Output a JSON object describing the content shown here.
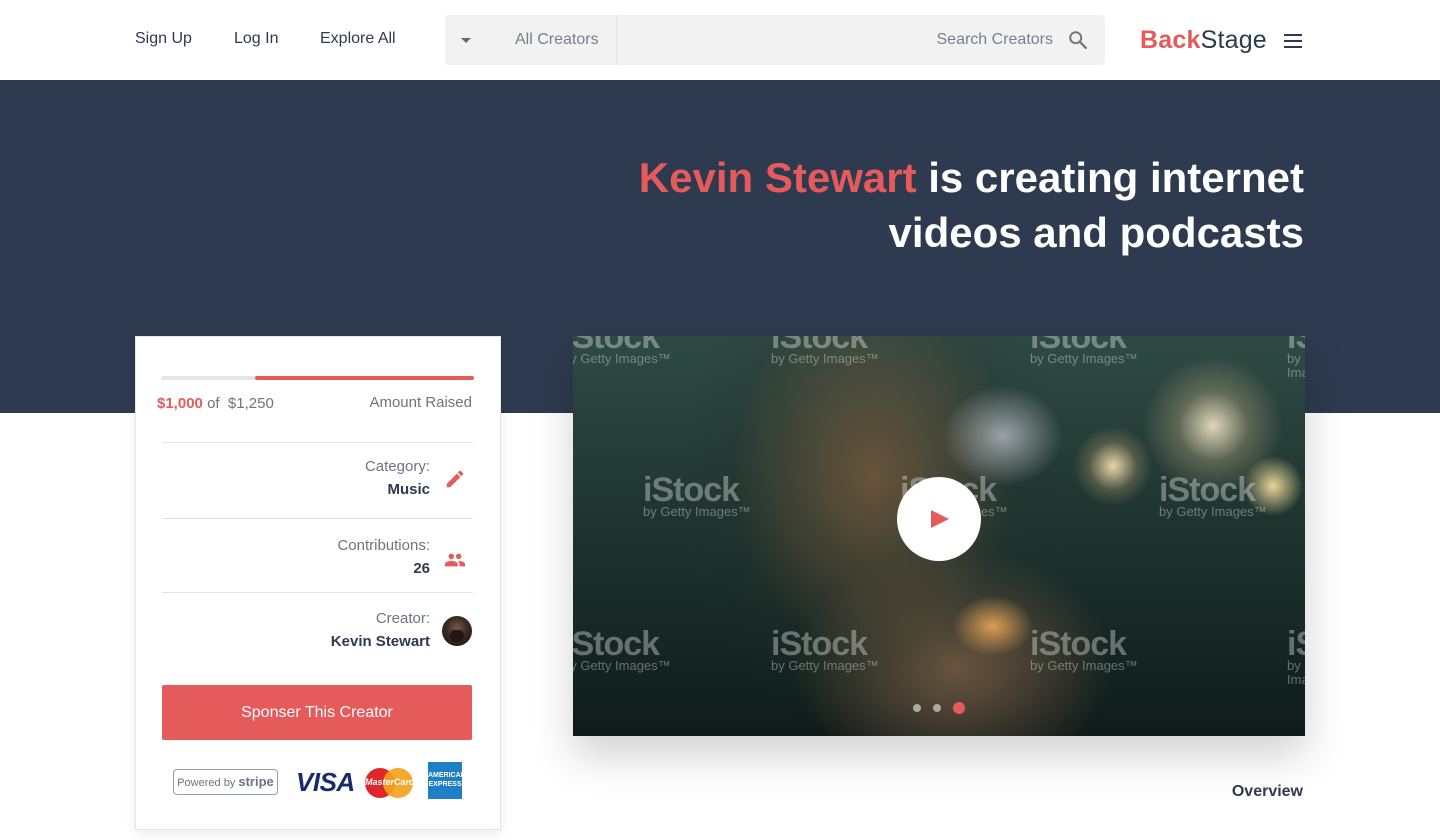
{
  "nav": {
    "sign_up": "Sign Up",
    "log_in": "Log In",
    "explore_all": "Explore All"
  },
  "search": {
    "dropdown_value": "All Creators",
    "placeholder": "Search Creators",
    "icon": "search-icon"
  },
  "brand": {
    "part1": "Back",
    "part2": "Stage",
    "accent_color": "#e55b5b",
    "dark_color": "#2e3a4e"
  },
  "hero": {
    "creator_name": "Kevin Stewart",
    "headline_rest": " is creating internet videos and podcasts",
    "background_color": "#2e3a4f"
  },
  "funding": {
    "raised": "$1,000",
    "of_text": "of",
    "goal": "$1,250",
    "label": "Amount Raised",
    "progress_start_fraction": 0.3,
    "progress_fraction": 0.7
  },
  "details": {
    "category_label": "Category:",
    "category_value": "Music",
    "category_icon": "pencil-icon",
    "contributions_label": "Contributions:",
    "contributions_value": "26",
    "contributions_icon": "people-icon",
    "creator_label": "Creator:",
    "creator_value": "Kevin Stewart"
  },
  "sponsor_button": "Sponser This Creator",
  "payments": {
    "stripe_text": "Powered by",
    "stripe_brand": "stripe",
    "visa": "VISA",
    "mastercard": "MasterCard",
    "amex": "AMERICAN EXPRESS"
  },
  "video": {
    "watermark_brand": "iStock",
    "watermark_sub": "by Getty Images™",
    "play_icon": "play-icon",
    "slides": 3,
    "active_slide": 3
  },
  "overview_link": "Overview"
}
